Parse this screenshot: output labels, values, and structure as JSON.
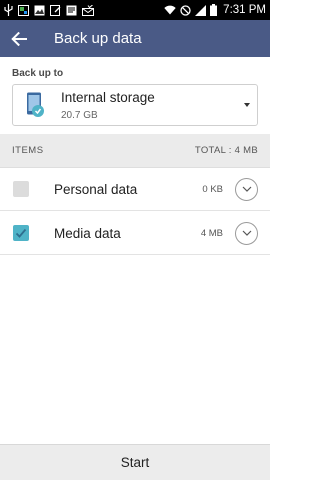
{
  "status_bar": {
    "time": "7:31 PM",
    "icons": [
      "usb-icon",
      "gallery-icon",
      "image-icon",
      "note-icon",
      "news-icon",
      "mail-check-icon",
      "wifi-icon",
      "do-not-disturb-icon",
      "signal-icon",
      "battery-icon"
    ]
  },
  "app_bar": {
    "title": "Back up data",
    "back_icon": "arrow-left-icon",
    "color": "#4a5a86"
  },
  "backup_target": {
    "label": "Back up to",
    "storage_name": "Internal storage",
    "storage_size": "20.7 GB"
  },
  "items_header": {
    "label": "ITEMS",
    "total": "TOTAL : 4 MB"
  },
  "items": [
    {
      "name": "Personal data",
      "size": "0 KB",
      "checked": false
    },
    {
      "name": "Media data",
      "size": "4 MB",
      "checked": true
    }
  ],
  "footer": {
    "start_label": "Start"
  },
  "colors": {
    "accent": "#4fb3c7",
    "header_bg": "#ebebeb"
  }
}
